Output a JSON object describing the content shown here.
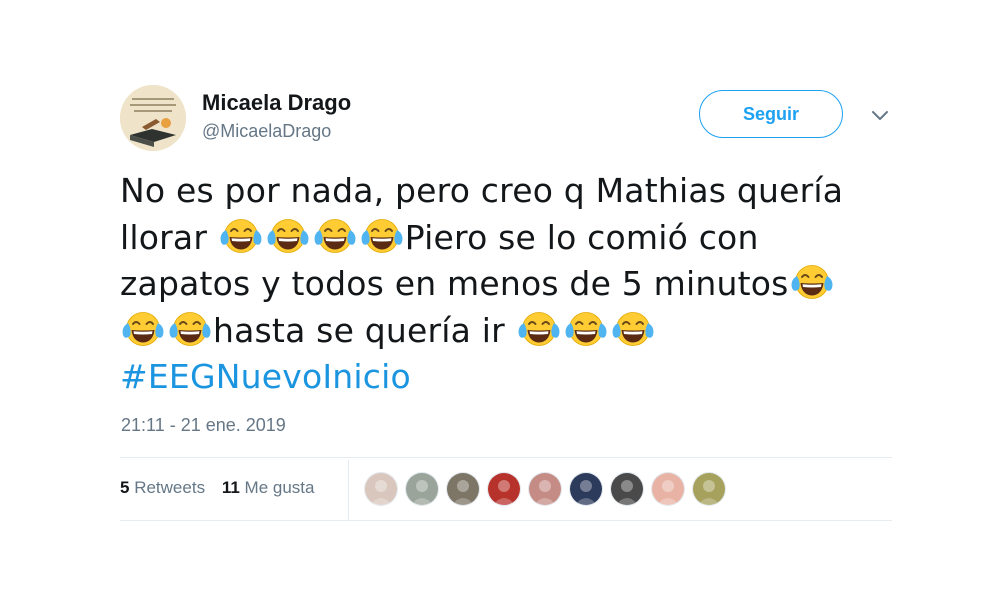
{
  "user": {
    "name": "Micaela Drago",
    "handle": "@MicaelaDrago",
    "avatar_icon": "book-quote-avatar"
  },
  "follow_button": {
    "label": "Seguir"
  },
  "menu_icon": "chevron-down-icon",
  "tweet": {
    "line1": "No es por nada, pero creo q Mathias quería",
    "line2_a": "llorar ",
    "line2_b": "Piero se lo comió con",
    "line3": "zapatos y todos en menos de 5 minutos",
    "line4": "hasta se quería ir ",
    "hashtag": "#EEGNuevoInicio",
    "emoji_name": "face-with-tears-of-joy"
  },
  "timestamp": "21:11 - 21 ene. 2019",
  "stats": {
    "retweets_count": "5",
    "retweets_label": "Retweets",
    "likes_count": "11",
    "likes_label": "Me gusta"
  },
  "likers": [
    {
      "icon": "user-avatar",
      "color": "#d9c7bd"
    },
    {
      "icon": "user-avatar",
      "color": "#9aa49a"
    },
    {
      "icon": "user-avatar",
      "color": "#7d7565"
    },
    {
      "icon": "user-avatar",
      "color": "#b8322c"
    },
    {
      "icon": "user-avatar",
      "color": "#c58c86"
    },
    {
      "icon": "user-avatar",
      "color": "#2c3a5b"
    },
    {
      "icon": "user-avatar",
      "color": "#4a4a4a"
    },
    {
      "icon": "user-avatar",
      "color": "#e8b3a5"
    },
    {
      "icon": "user-avatar",
      "color": "#a6a15d"
    }
  ],
  "colors": {
    "accent": "#1da1f2",
    "hashtag": "#1b95e0",
    "muted": "#657786",
    "text": "#14171a"
  }
}
